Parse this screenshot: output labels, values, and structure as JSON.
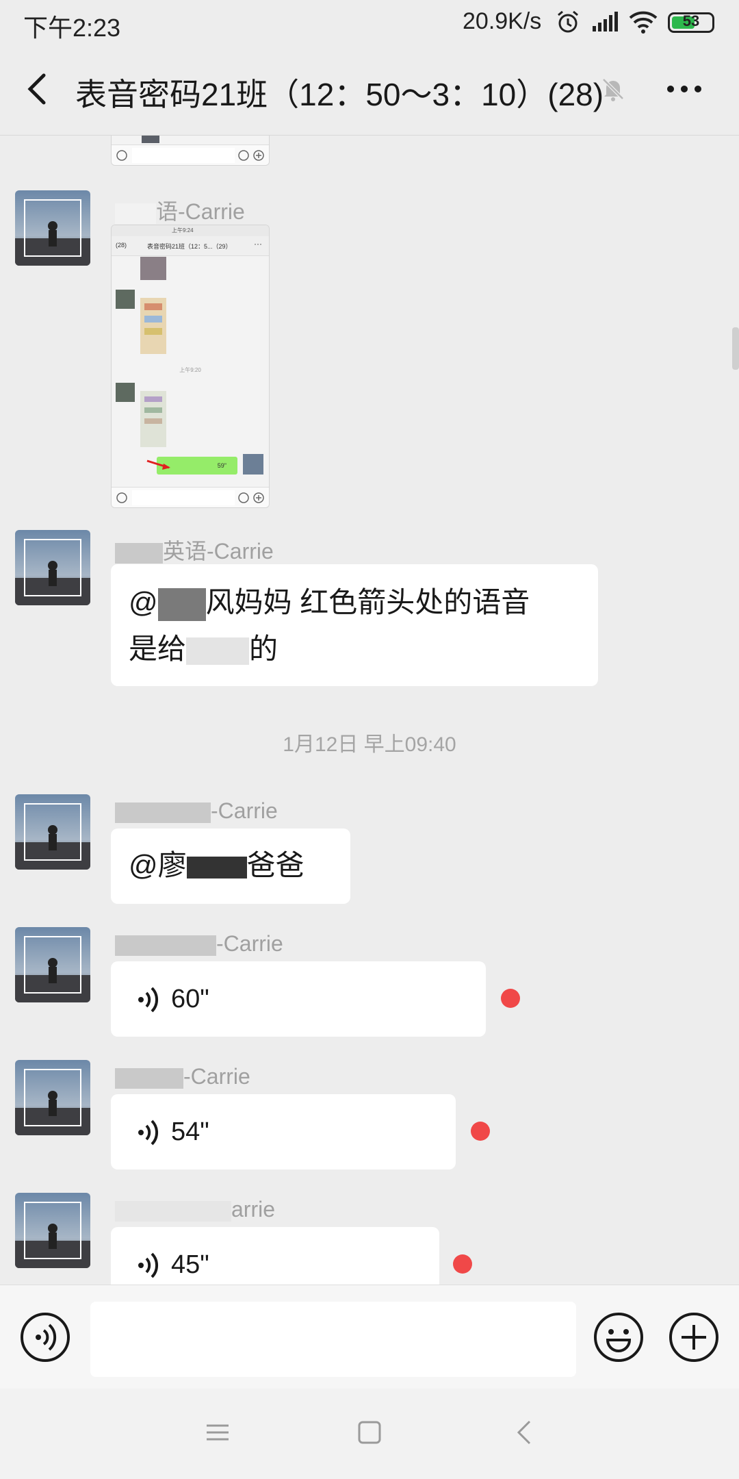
{
  "status_bar": {
    "time": "下午2:23",
    "net_speed": "20.9K/s",
    "battery": "53"
  },
  "header": {
    "title": "表音密码21班（12：50～3：10）(28)"
  },
  "messages": [
    {
      "sender_suffix": "语-Carrie"
    },
    {
      "sender_suffix": "英语-Carrie",
      "text_line1": "@",
      "text_line1b": "风妈妈  红色箭头处的语音",
      "text_line2": "是给",
      "text_line2b": "的"
    },
    {
      "sender_suffix": "-Carrie",
      "text_a": "@廖",
      "text_b": "爸爸"
    },
    {
      "sender_suffix": "-Carrie",
      "duration": "60\""
    },
    {
      "sender_suffix": "-Carrie",
      "duration": "54\""
    },
    {
      "sender_suffix": "arrie",
      "duration": "45\""
    }
  ],
  "timestamp": "1月12日 早上09:40",
  "embedded_screenshot": {
    "status_time": "上午9:24",
    "back_count": "(28)",
    "title": "表音密码21班（12：5...（29）",
    "time_divider": "上午9:20",
    "voice_duration": "59\""
  },
  "icons": {
    "back": "chevron-left-icon",
    "mute": "bell-off-icon",
    "more": "more-dots-icon",
    "voice_toggle": "voice-icon",
    "emoji": "emoji-icon",
    "plus": "plus-icon"
  },
  "colors": {
    "background": "#ededed",
    "bubble": "#ffffff",
    "unread_dot": "#f04848",
    "voice_bubble_sent": "#95ec69"
  }
}
